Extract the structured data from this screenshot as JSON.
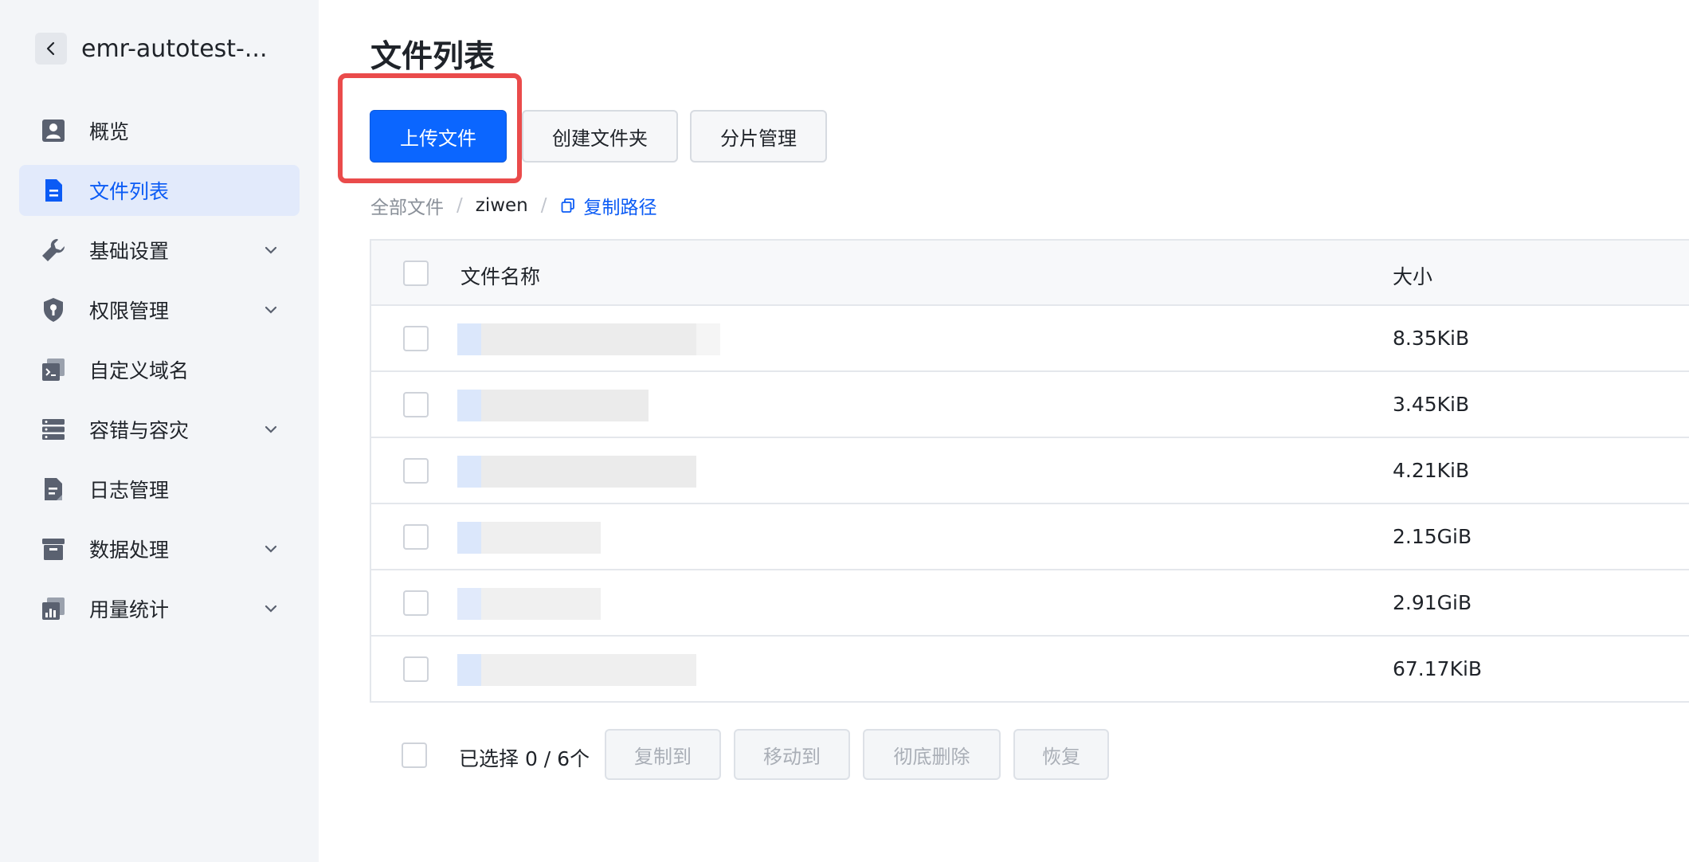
{
  "sidebar": {
    "bucket_name": "emr-autotest-...",
    "items": [
      {
        "label": "概览",
        "icon": "overview-icon",
        "active": false,
        "expandable": false
      },
      {
        "label": "文件列表",
        "icon": "file-list-icon",
        "active": true,
        "expandable": false
      },
      {
        "label": "基础设置",
        "icon": "wrench-icon",
        "active": false,
        "expandable": true
      },
      {
        "label": "权限管理",
        "icon": "shield-icon",
        "active": false,
        "expandable": true
      },
      {
        "label": "自定义域名",
        "icon": "terminal-icon",
        "active": false,
        "expandable": false
      },
      {
        "label": "容错与容灾",
        "icon": "server-icon",
        "active": false,
        "expandable": true
      },
      {
        "label": "日志管理",
        "icon": "log-file-icon",
        "active": false,
        "expandable": false
      },
      {
        "label": "数据处理",
        "icon": "archive-box-icon",
        "active": false,
        "expandable": true
      },
      {
        "label": "用量统计",
        "icon": "bar-chart-icon",
        "active": false,
        "expandable": true
      }
    ]
  },
  "main": {
    "title": "文件列表",
    "toolbar": {
      "upload_label": "上传文件",
      "create_folder_label": "创建文件夹",
      "parts_label": "分片管理"
    },
    "breadcrumb": {
      "root": "全部文件",
      "separator": "/",
      "current": "ziwen",
      "copy_path_label": "复制路径"
    },
    "table": {
      "columns": {
        "name": "文件名称",
        "size": "大小"
      },
      "rows": [
        {
          "size": "8.35KiB"
        },
        {
          "size": "3.45KiB"
        },
        {
          "size": "4.21KiB"
        },
        {
          "size": "2.15GiB"
        },
        {
          "size": "2.91GiB"
        },
        {
          "size": "67.17KiB"
        }
      ]
    },
    "footer": {
      "selected_text": "已选择 0 / 6个",
      "copy_to_label": "复制到",
      "move_to_label": "移动到",
      "delete_label": "彻底删除",
      "restore_label": "恢复"
    }
  },
  "colors": {
    "primary": "#0b66ff",
    "highlight": "#ea4b4b",
    "active_bg": "#e2eafb",
    "sidebar_bg": "#f3f5f8"
  }
}
